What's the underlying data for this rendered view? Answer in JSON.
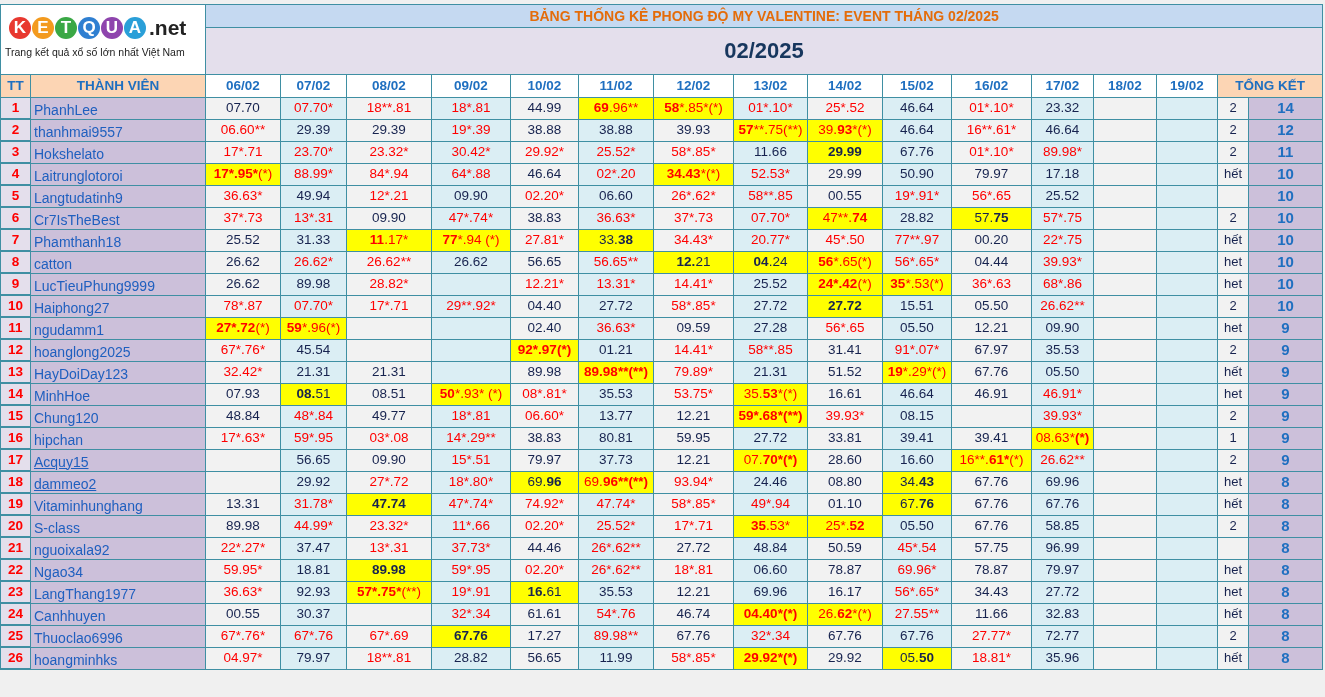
{
  "logo": {
    "letters": [
      {
        "char": "K",
        "color": "#e8382f"
      },
      {
        "char": "E",
        "color": "#f39a1e"
      },
      {
        "char": "T",
        "color": "#3aa845"
      },
      {
        "char": "Q",
        "color": "#2f7fd1"
      },
      {
        "char": "U",
        "color": "#8e44ad"
      },
      {
        "char": "A",
        "color": "#2a9fd8"
      }
    ],
    "suffix": ".net",
    "tagline": "Trang kết quả xổ số lớn nhất Việt Nam"
  },
  "title": "BẢNG THỐNG KÊ PHONG ĐỘ MY VALENTINE: EVENT THÁNG 02/2025",
  "month": "02/2025",
  "columns": {
    "index": "TT",
    "member": "THÀNH VIÊN",
    "dates": [
      "06/02",
      "07/02",
      "08/02",
      "09/02",
      "10/02",
      "11/02",
      "12/02",
      "13/02",
      "14/02",
      "15/02",
      "16/02",
      "17/02",
      "18/02",
      "19/02"
    ],
    "summary": "TỔNG KẾT"
  },
  "rows": [
    {
      "index": "1",
      "name": "PhanhLee",
      "underlined": false,
      "remaining": "2",
      "total": "14",
      "cells": [
        "07.70",
        {
          "text": "07.70*",
          "red": true
        },
        {
          "text": "18**.81",
          "red": true
        },
        {
          "text": "18*.81",
          "red": true
        },
        "44.99",
        {
          "parts": [
            {
              "bold": "69"
            },
            {
              "text": ".96**"
            }
          ],
          "red": true,
          "highlighted": true
        },
        {
          "parts": [
            {
              "bold": "58"
            },
            {
              "text": "*.85*(*)"
            }
          ],
          "red": true,
          "highlighted": true
        },
        {
          "text": "01*.10*",
          "red": true
        },
        {
          "text": "25*.52",
          "red": true
        },
        "46.64",
        {
          "text": "01*.10*",
          "red": true
        },
        "23.32"
      ]
    },
    {
      "index": "2",
      "name": "thanhmai9557",
      "underlined": false,
      "remaining": "2",
      "total": "12",
      "cells": [
        {
          "text": "06.60**",
          "red": true
        },
        "29.39",
        "29.39",
        {
          "text": "19*.39",
          "red": true
        },
        "38.88",
        "38.88",
        "39.93",
        {
          "parts": [
            {
              "bold": "57"
            },
            {
              "text": "**.75(**)"
            }
          ],
          "red": true,
          "highlighted": true
        },
        {
          "parts": [
            {
              "text": "39."
            },
            {
              "bold": "93"
            },
            {
              "text": "*(*)"
            }
          ],
          "red": true,
          "highlighted": true
        },
        "46.64",
        {
          "text": "16**.61*",
          "red": true
        },
        "46.64"
      ]
    },
    {
      "index": "3",
      "name": "Hokshelato",
      "underlined": false,
      "remaining": "2",
      "total": "11",
      "cells": [
        {
          "text": "17*.71",
          "red": true
        },
        {
          "text": "23.70*",
          "red": true
        },
        {
          "text": "23.32*",
          "red": true
        },
        {
          "text": "30.42*",
          "red": true
        },
        {
          "text": "29.92*",
          "red": true
        },
        {
          "text": "25.52*",
          "red": true
        },
        {
          "text": "58*.85*",
          "red": true
        },
        "11.66",
        {
          "parts": [
            {
              "bold": "29.99"
            }
          ],
          "red": false,
          "highlighted": true
        },
        "67.76",
        {
          "text": "01*.10*",
          "red": true
        },
        {
          "text": "89.98*",
          "red": true
        }
      ]
    },
    {
      "index": "4",
      "name": "Laitrunglotoroi",
      "underlined": false,
      "remaining": "hết",
      "total": "10",
      "cells": [
        {
          "parts": [
            {
              "bold": "17*.95*"
            },
            {
              "text": "(*)"
            }
          ],
          "red": true,
          "highlighted": true
        },
        {
          "text": "88.99*",
          "red": true
        },
        {
          "text": "84*.94",
          "red": true
        },
        {
          "text": "64*.88",
          "red": true
        },
        "46.64",
        {
          "text": "02*.20",
          "red": true
        },
        {
          "parts": [
            {
              "bold": "34.43"
            },
            {
              "text": "*(*)"
            }
          ],
          "red": true,
          "highlighted": true
        },
        {
          "text": "52.53*",
          "red": true
        },
        "29.99",
        "50.90",
        "79.97",
        "17.18"
      ]
    },
    {
      "index": "5",
      "name": "Langtudatinh9",
      "underlined": false,
      "total": "10",
      "cells": [
        {
          "text": "36.63*",
          "red": true
        },
        "49.94",
        {
          "text": "12*.21",
          "red": true
        },
        "09.90",
        {
          "text": "02.20*",
          "red": true
        },
        "06.60",
        {
          "text": "26*.62*",
          "red": true
        },
        {
          "text": "58**.85",
          "red": true
        },
        "00.55",
        {
          "text": "19*.91*",
          "red": true
        },
        {
          "text": "56*.65",
          "red": true
        },
        "25.52"
      ]
    },
    {
      "index": "6",
      "name": "Cr7IsTheBest",
      "underlined": false,
      "remaining": "2",
      "total": "10",
      "cells": [
        {
          "text": "37*.73",
          "red": true
        },
        {
          "text": "13*.31",
          "red": true
        },
        "09.90",
        {
          "text": "47*.74*",
          "red": true
        },
        "38.83",
        {
          "text": "36.63*",
          "red": true
        },
        {
          "text": "37*.73",
          "red": true
        },
        {
          "text": "07.70*",
          "red": true
        },
        {
          "parts": [
            {
              "text": "47**."
            },
            {
              "bold": "74"
            }
          ],
          "red": true,
          "highlighted": true
        },
        "28.82",
        {
          "parts": [
            {
              "text": "57."
            },
            {
              "bold": "75"
            }
          ],
          "red": false,
          "highlighted": true
        },
        {
          "text": "57*.75",
          "red": true
        }
      ]
    },
    {
      "index": "7",
      "name": "Phamthanh18",
      "underlined": false,
      "remaining": "hết",
      "total": "10",
      "cells": [
        "25.52",
        "31.33",
        {
          "parts": [
            {
              "bold": "11"
            },
            {
              "text": ".17*"
            }
          ],
          "red": true,
          "highlighted": true
        },
        {
          "parts": [
            {
              "bold": "77"
            },
            {
              "text": "*.94 (*)"
            }
          ],
          "red": true,
          "highlighted": true
        },
        {
          "text": "27.81*",
          "red": true
        },
        {
          "parts": [
            {
              "text": "33."
            },
            {
              "bold": "38"
            }
          ],
          "red": false,
          "highlighted": true
        },
        {
          "text": "34.43*",
          "red": true
        },
        {
          "text": "20.77*",
          "red": true
        },
        {
          "text": "45*.50",
          "red": true
        },
        {
          "text": "77**.97",
          "red": true
        },
        "00.20",
        {
          "text": "22*.75",
          "red": true
        }
      ]
    },
    {
      "index": "8",
      "name": "catton",
      "underlined": false,
      "remaining": "het",
      "total": "10",
      "cells": [
        "26.62",
        {
          "text": "26.62*",
          "red": true
        },
        {
          "text": "26.62**",
          "red": true
        },
        "26.62",
        "56.65",
        {
          "text": "56.65**",
          "red": true
        },
        {
          "parts": [
            {
              "bold": "12."
            },
            {
              "text": "21"
            }
          ],
          "red": false,
          "highlighted": true
        },
        {
          "parts": [
            {
              "bold": "04"
            },
            {
              "text": ".24"
            }
          ],
          "red": false,
          "highlighted": true
        },
        {
          "parts": [
            {
              "bold": "56"
            },
            {
              "text": "*.65(*)"
            }
          ],
          "red": true,
          "highlighted": true
        },
        {
          "text": "56*.65*",
          "red": true
        },
        "04.44",
        {
          "text": "39.93*",
          "red": true
        }
      ]
    },
    {
      "index": "9",
      "name": "LucTieuPhung9999",
      "underlined": false,
      "remaining": "het",
      "total": "10",
      "cells": [
        "26.62",
        "89.98",
        {
          "text": "28.82*",
          "red": true
        },
        "",
        {
          "text": "12.21*",
          "red": true
        },
        {
          "text": "13.31*",
          "red": true
        },
        {
          "text": "14.41*",
          "red": true
        },
        "25.52",
        {
          "parts": [
            {
              "bold": "24*.42"
            },
            {
              "text": "(*)"
            }
          ],
          "red": true,
          "highlighted": true
        },
        {
          "parts": [
            {
              "bold": "35"
            },
            {
              "text": "*.53(*)"
            }
          ],
          "red": true,
          "highlighted": true
        },
        {
          "text": "36*.63",
          "red": true
        },
        {
          "text": "68*.86",
          "red": true
        }
      ]
    },
    {
      "index": "10",
      "name": "Haiphong27",
      "underlined": false,
      "remaining": "2",
      "total": "10",
      "cells": [
        {
          "text": "78*.87",
          "red": true
        },
        {
          "text": "07.70*",
          "red": true
        },
        {
          "text": "17*.71",
          "red": true
        },
        {
          "text": "29**.92*",
          "red": true
        },
        "04.40",
        "27.72",
        {
          "text": "58*.85*",
          "red": true
        },
        "27.72",
        {
          "parts": [
            {
              "bold": "27.72"
            }
          ],
          "red": false,
          "highlighted": true
        },
        "15.51",
        "05.50",
        {
          "text": "26.62**",
          "red": true
        }
      ]
    },
    {
      "index": "11",
      "name": "ngudamm1",
      "underlined": false,
      "remaining": "het",
      "total": "9",
      "cells": [
        {
          "parts": [
            {
              "bold": "27*.72"
            },
            {
              "text": "(*)"
            }
          ],
          "red": true,
          "highlighted": true
        },
        {
          "parts": [
            {
              "bold": "59"
            },
            {
              "text": "*.96(*)"
            }
          ],
          "red": true,
          "highlighted": true
        },
        "",
        "",
        "02.40",
        {
          "text": "36.63*",
          "red": true
        },
        "09.59",
        "27.28",
        {
          "text": "56*.65",
          "red": true
        },
        "05.50",
        "12.21",
        "09.90"
      ]
    },
    {
      "index": "12",
      "name": "hoanglong2025",
      "underlined": false,
      "remaining": "2",
      "total": "9",
      "cells": [
        {
          "text": "67*.76*",
          "red": true
        },
        "45.54",
        "",
        "",
        {
          "parts": [
            {
              "bold": "92*.97(*)"
            }
          ],
          "red": true,
          "highlighted": true
        },
        "01.21",
        {
          "text": "14.41*",
          "red": true
        },
        {
          "text": "58**.85",
          "red": true
        },
        "31.41",
        {
          "text": "91*.07*",
          "red": true
        },
        "67.97",
        "35.53"
      ]
    },
    {
      "index": "13",
      "name": "HayDoiDay123",
      "underlined": false,
      "remaining": "hết",
      "total": "9",
      "cells": [
        {
          "text": "32.42*",
          "red": true
        },
        "21.31",
        "21.31",
        "",
        "89.98",
        {
          "parts": [
            {
              "bold": "89.98**(**)"
            }
          ],
          "red": true,
          "highlighted": true
        },
        {
          "text": "79.89*",
          "red": true
        },
        "21.31",
        "51.52",
        {
          "parts": [
            {
              "bold": "19"
            },
            {
              "text": "*.29*(*)"
            }
          ],
          "red": true,
          "highlighted": true
        },
        "67.76",
        "05.50"
      ]
    },
    {
      "index": "14",
      "name": "MinhHoe",
      "underlined": false,
      "remaining": "het",
      "total": "9",
      "cells": [
        "07.93",
        {
          "parts": [
            {
              "bold": "08."
            },
            {
              "text": "51"
            }
          ],
          "red": false,
          "highlighted": true
        },
        "08.51",
        {
          "parts": [
            {
              "bold": "50"
            },
            {
              "text": "*.93* (*)"
            }
          ],
          "red": true,
          "highlighted": true
        },
        {
          "text": "08*.81*",
          "red": true
        },
        "35.53",
        {
          "text": "53.75*",
          "red": true
        },
        {
          "parts": [
            {
              "text": "35."
            },
            {
              "bold": "53"
            },
            {
              "text": "*(*)"
            }
          ],
          "red": true,
          "highlighted": true
        },
        "16.61",
        "46.64",
        "46.91",
        {
          "text": "46.91*",
          "red": true
        }
      ]
    },
    {
      "index": "15",
      "name": "Chung120",
      "underlined": false,
      "remaining": "2",
      "total": "9",
      "cells": [
        "48.84",
        {
          "text": "48*.84",
          "red": true
        },
        "49.77",
        {
          "text": "18*.81",
          "red": true
        },
        {
          "text": "06.60*",
          "red": true
        },
        "13.77",
        "12.21",
        {
          "parts": [
            {
              "bold": "59*.68*(**)"
            }
          ],
          "red": true,
          "highlighted": true
        },
        {
          "text": "39.93*",
          "red": true
        },
        "08.15",
        "",
        {
          "text": "39.93*",
          "red": true
        }
      ]
    },
    {
      "index": "16",
      "name": "hipchan",
      "underlined": false,
      "remaining": "1",
      "total": "9",
      "cells": [
        {
          "text": "17*.63*",
          "red": true
        },
        {
          "text": "59*.95",
          "red": true
        },
        {
          "text": "03*.08",
          "red": true
        },
        {
          "text": "14*.29**",
          "red": true
        },
        "38.83",
        "80.81",
        "59.95",
        "27.72",
        "33.81",
        "39.41",
        "39.41",
        {
          "parts": [
            {
              "text": "08.63*"
            },
            {
              "bold": "(*)"
            }
          ],
          "red": true,
          "highlighted": true
        }
      ]
    },
    {
      "index": "17",
      "name": "Acquy15",
      "underlined": true,
      "remaining": "2",
      "total": "9",
      "cells": [
        "",
        "56.65",
        "09.90",
        {
          "text": "15*.51",
          "red": true
        },
        "79.97",
        "37.73",
        "12.21",
        {
          "parts": [
            {
              "text": "07."
            },
            {
              "bold": "70*(*)"
            }
          ],
          "red": true,
          "highlighted": true
        },
        "28.60",
        "16.60",
        {
          "parts": [
            {
              "text": "16**."
            },
            {
              "bold": "61*"
            },
            {
              "text": "(*)"
            }
          ],
          "red": true,
          "highlighted": true
        },
        {
          "text": "26.62**",
          "red": true
        }
      ]
    },
    {
      "index": "18",
      "name": "dammeo2",
      "underlined": true,
      "remaining": "het",
      "total": "8",
      "cells": [
        "",
        "29.92",
        {
          "text": "27*.72",
          "red": true
        },
        {
          "text": "18*.80*",
          "red": true
        },
        {
          "parts": [
            {
              "text": "69."
            },
            {
              "bold": "96"
            }
          ],
          "red": false,
          "highlighted": true
        },
        {
          "parts": [
            {
              "text": "69."
            },
            {
              "bold": "96**(**)"
            }
          ],
          "red": true,
          "highlighted": true
        },
        {
          "text": "93.94*",
          "red": true
        },
        "24.46",
        "08.80",
        {
          "parts": [
            {
              "text": "34."
            },
            {
              "bold": "43"
            }
          ],
          "red": false,
          "highlighted": true
        },
        "67.76",
        "69.96"
      ]
    },
    {
      "index": "19",
      "name": "Vitaminhunghang",
      "underlined": false,
      "remaining": "hết",
      "total": "8",
      "cells": [
        "13.31",
        {
          "text": "31.78*",
          "red": true
        },
        {
          "parts": [
            {
              "bold": "47.74"
            }
          ],
          "red": false,
          "highlighted": true
        },
        {
          "text": "47*.74*",
          "red": true
        },
        {
          "text": "74.92*",
          "red": true
        },
        {
          "text": "47.74*",
          "red": true
        },
        {
          "text": "58*.85*",
          "red": true
        },
        {
          "text": "49*.94",
          "red": true
        },
        "01.10",
        {
          "parts": [
            {
              "text": "67."
            },
            {
              "bold": "76"
            }
          ],
          "red": false,
          "highlighted": true
        },
        "67.76",
        "67.76"
      ]
    },
    {
      "index": "20",
      "name": "S-class",
      "underlined": false,
      "remaining": "2",
      "total": "8",
      "cells": [
        "89.98",
        {
          "text": "44.99*",
          "red": true
        },
        {
          "text": "23.32*",
          "red": true
        },
        {
          "text": "11*.66",
          "red": true
        },
        {
          "text": "02.20*",
          "red": true
        },
        {
          "text": "25.52*",
          "red": true
        },
        {
          "text": "17*.71",
          "red": true
        },
        {
          "parts": [
            {
              "bold": "35"
            },
            {
              "text": ".53*"
            }
          ],
          "red": true,
          "highlighted": true
        },
        {
          "parts": [
            {
              "text": "25*."
            },
            {
              "bold": "52"
            }
          ],
          "red": true,
          "highlighted": true
        },
        "05.50",
        "67.76",
        "58.85"
      ]
    },
    {
      "index": "21",
      "name": "nguoixala92",
      "underlined": false,
      "total": "8",
      "cells": [
        {
          "text": "22*.27*",
          "red": true
        },
        "37.47",
        {
          "text": "13*.31",
          "red": true
        },
        {
          "text": "37.73*",
          "red": true
        },
        "44.46",
        {
          "text": "26*.62**",
          "red": true
        },
        "27.72",
        "48.84",
        "50.59",
        {
          "text": "45*.54",
          "red": true
        },
        "57.75",
        "96.99"
      ]
    },
    {
      "index": "22",
      "name": "Ngao34",
      "underlined": false,
      "remaining": "het",
      "total": "8",
      "cells": [
        {
          "text": "59.95*",
          "red": true
        },
        "18.81",
        {
          "parts": [
            {
              "bold": "89.98"
            }
          ],
          "red": false,
          "highlighted": true
        },
        {
          "text": "59*.95",
          "red": true
        },
        {
          "text": "02.20*",
          "red": true
        },
        {
          "text": "26*.62**",
          "red": true
        },
        {
          "text": "18*.81",
          "red": true
        },
        "06.60",
        "78.87",
        {
          "text": "69.96*",
          "red": true
        },
        "78.87",
        "79.97"
      ]
    },
    {
      "index": "23",
      "name": "LangThang1977",
      "underlined": false,
      "remaining": "het",
      "total": "8",
      "cells": [
        {
          "text": "36.63*",
          "red": true
        },
        "92.93",
        {
          "parts": [
            {
              "bold": "57*.75*"
            },
            {
              "text": "(**)"
            }
          ],
          "red": true,
          "highlighted": true
        },
        {
          "text": "19*.91",
          "red": true
        },
        {
          "parts": [
            {
              "bold": "16."
            },
            {
              "text": "61"
            }
          ],
          "red": false,
          "highlighted": true
        },
        "35.53",
        "12.21",
        "69.96",
        "16.17",
        {
          "text": "56*.65*",
          "red": true
        },
        "34.43",
        "27.72"
      ]
    },
    {
      "index": "24",
      "name": "Canhhuyen",
      "underlined": false,
      "remaining": "hết",
      "total": "8",
      "cells": [
        "00.55",
        "30.37",
        "",
        {
          "text": "32*.34",
          "red": true
        },
        "61.61",
        {
          "text": "54*.76",
          "red": true
        },
        "46.74",
        {
          "parts": [
            {
              "bold": "04.40*(*)"
            }
          ],
          "red": true,
          "highlighted": true
        },
        {
          "parts": [
            {
              "text": "26."
            },
            {
              "bold": "62"
            },
            {
              "text": "*(*)"
            }
          ],
          "red": true,
          "highlighted": true
        },
        {
          "text": "27.55**",
          "red": true
        },
        "11.66",
        "32.83"
      ]
    },
    {
      "index": "25",
      "name": "Thuoclao6996",
      "underlined": false,
      "remaining": "2",
      "total": "8",
      "cells": [
        {
          "text": "67*.76*",
          "red": true
        },
        {
          "text": "67*.76",
          "red": true
        },
        {
          "text": "67*.69",
          "red": true
        },
        {
          "parts": [
            {
              "bold": "67.76"
            }
          ],
          "red": false,
          "highlighted": true
        },
        "17.27",
        {
          "text": "89.98**",
          "red": true
        },
        "67.76",
        {
          "text": "32*.34",
          "red": true
        },
        "67.76",
        "67.76",
        {
          "text": "27.77*",
          "red": true
        },
        "72.77"
      ]
    },
    {
      "index": "26",
      "name": "hoangminhks",
      "underlined": false,
      "remaining": "hết",
      "total": "8",
      "cells": [
        {
          "text": "04.97*",
          "red": true
        },
        "79.97",
        {
          "text": "18**.81",
          "red": true
        },
        "28.82",
        "56.65",
        "11.99",
        {
          "text": "58*.85*",
          "red": true
        },
        {
          "parts": [
            {
              "bold": "29.92*(*)"
            }
          ],
          "red": true,
          "highlighted": true
        },
        "29.92",
        {
          "parts": [
            {
              "text": "05."
            },
            {
              "bold": "50"
            }
          ],
          "red": false,
          "highlighted": true
        },
        {
          "text": "18.81*",
          "red": true
        },
        "35.96"
      ]
    }
  ]
}
